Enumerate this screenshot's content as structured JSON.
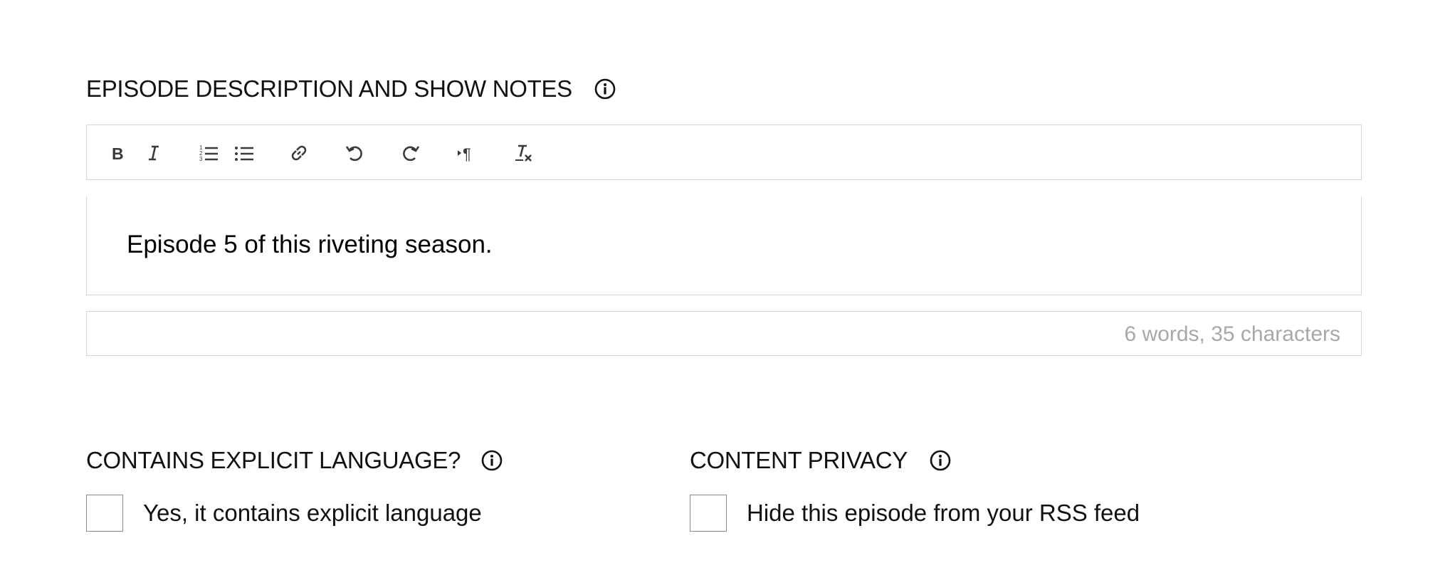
{
  "description_section": {
    "title": "EPISODE DESCRIPTION AND SHOW NOTES",
    "info_icon": "info-circle-icon"
  },
  "toolbar": {
    "buttons": [
      {
        "name": "bold",
        "icon": "bold-icon"
      },
      {
        "name": "italic",
        "icon": "italic-icon"
      },
      {
        "name": "ordered-list",
        "icon": "ordered-list-icon"
      },
      {
        "name": "bullet-list",
        "icon": "bullet-list-icon"
      },
      {
        "name": "link",
        "icon": "link-icon"
      },
      {
        "name": "undo",
        "icon": "undo-icon"
      },
      {
        "name": "redo",
        "icon": "redo-icon"
      },
      {
        "name": "paragraph-direction",
        "icon": "ltr-paragraph-icon"
      },
      {
        "name": "clear-formatting",
        "icon": "clear-formatting-icon"
      }
    ]
  },
  "editor": {
    "content": "Episode 5 of this riveting season.",
    "word_count": "6 words, 35 characters"
  },
  "explicit_section": {
    "title": "CONTAINS EXPLICIT LANGUAGE?",
    "info_icon": "info-circle-icon",
    "checkbox_label": "Yes, it contains explicit language",
    "checked": false
  },
  "privacy_section": {
    "title": "CONTENT PRIVACY",
    "info_icon": "info-circle-icon",
    "checkbox_label": "Hide this episode from your RSS feed",
    "checked": false
  },
  "colors": {
    "text": "#111111",
    "border": "#d7d7d7",
    "muted": "#a8a8a8",
    "icon": "#3a3a3a"
  }
}
